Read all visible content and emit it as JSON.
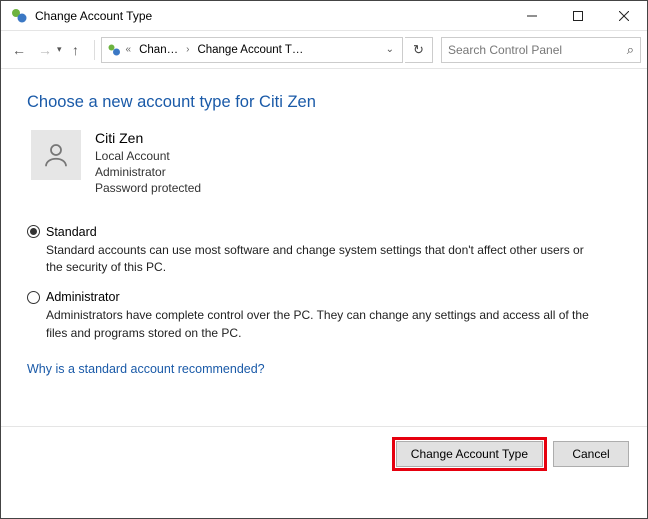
{
  "window": {
    "title": "Change Account Type"
  },
  "nav": {
    "breadcrumb1": "Chan…",
    "breadcrumb2": "Change Account T…",
    "search_placeholder": "Search Control Panel"
  },
  "page": {
    "heading": "Choose a new account type for Citi Zen",
    "user": {
      "name": "Citi Zen",
      "line1": "Local Account",
      "line2": "Administrator",
      "line3": "Password protected"
    },
    "options": {
      "standard": {
        "label": "Standard",
        "desc": "Standard accounts can use most software and change system settings that don't affect other users or the security of this PC."
      },
      "admin": {
        "label": "Administrator",
        "desc": "Administrators have complete control over the PC. They can change any settings and access all of the files and programs stored on the PC."
      }
    },
    "help_link": "Why is a standard account recommended?"
  },
  "footer": {
    "primary": "Change Account Type",
    "cancel": "Cancel"
  }
}
